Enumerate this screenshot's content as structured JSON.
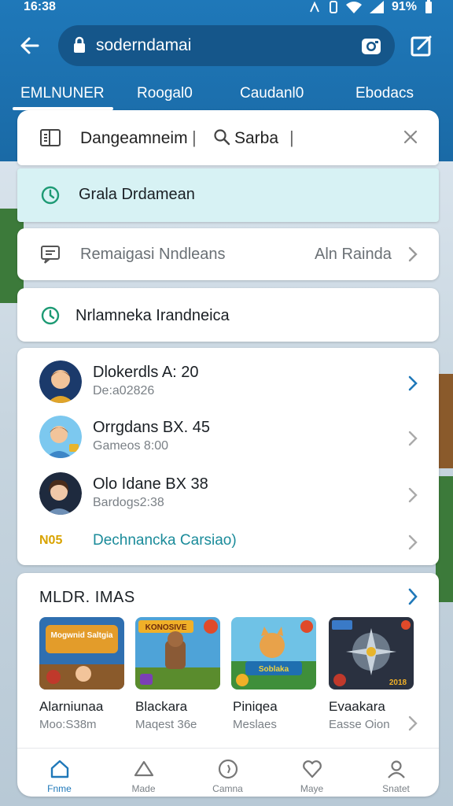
{
  "status": {
    "time": "16:38",
    "battery": "91%"
  },
  "topbar": {
    "url": "soderndamai"
  },
  "tabs": [
    "EMLNUNER",
    "Roogal0",
    "Caudanl0",
    "Ebodacs"
  ],
  "search": {
    "query1": "Dangeamneim",
    "separator": "|",
    "query2": "Sarba",
    "separator2": "|"
  },
  "suggestion": {
    "text": "Grala Drdamean"
  },
  "remember": {
    "text": "Remaigasi Nndleans",
    "right": "Aln Rainda"
  },
  "nd_item": {
    "text": "Nrlamneka Irandneica"
  },
  "list": [
    {
      "title": "Dlokerdls A: 20",
      "sub": "De:a02826"
    },
    {
      "title": "Orrgdans BX. 45",
      "sub": "Gameos 8:00"
    },
    {
      "title": "Olo Idane BX 38",
      "sub": "Bardogs2:38"
    }
  ],
  "linkrow": {
    "badge": "N05",
    "text": "Dechnancka Carsiao)"
  },
  "games": {
    "heading": "MLDR. IMAS",
    "tiles": [
      {
        "name": "Alarniunaa",
        "sub": "Moo:S38m",
        "art_label": "Mogwnid Saltgia"
      },
      {
        "name": "Blackara",
        "sub": "Maqest 36e",
        "art_label": "KONOSIVE"
      },
      {
        "name": "Piniqea",
        "sub": "Meslaes",
        "art_label": "Soblaka"
      },
      {
        "name": "Evaakara",
        "sub": "Easse Oion",
        "art_label": "2018"
      }
    ]
  },
  "nav": [
    {
      "label": "Fnme",
      "icon": "home-icon",
      "active": true
    },
    {
      "label": "Made",
      "icon": "triangle-icon",
      "active": false
    },
    {
      "label": "Camna",
      "icon": "compass-icon",
      "active": false
    },
    {
      "label": "Maye",
      "icon": "heart-icon",
      "active": false
    },
    {
      "label": "Snatet",
      "icon": "profile-icon",
      "active": false
    }
  ],
  "colors": {
    "header": "#1f78b9",
    "accent": "#1f78b9",
    "highlight": "#d7f2f4",
    "link": "#1a8b9a",
    "badge": "#d9a300"
  }
}
